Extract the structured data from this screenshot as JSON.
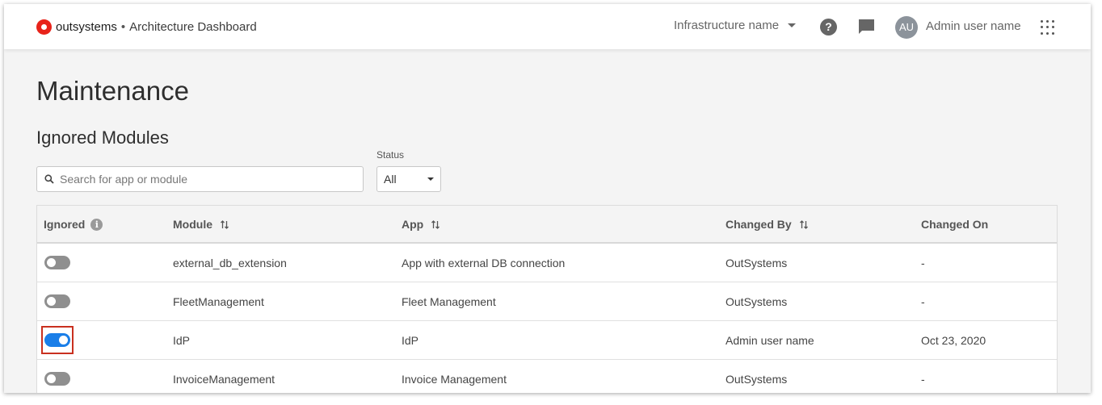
{
  "header": {
    "brand_name": "outsystems",
    "brand_separator": "•",
    "app_name": "Architecture Dashboard",
    "infrastructure_label": "Infrastructure name",
    "help_icon": "help-circle-icon",
    "chat_icon": "chat-bubble-icon",
    "avatar_initials": "AU",
    "user_name": "Admin user name",
    "apps_icon": "grid-apps-icon"
  },
  "page": {
    "title": "Maintenance",
    "section_title": "Ignored Modules"
  },
  "filters": {
    "search_placeholder": "Search for app or module",
    "search_value": "",
    "status_label": "Status",
    "status_value": "All"
  },
  "table": {
    "columns": {
      "ignored": "Ignored",
      "module": "Module",
      "app": "App",
      "changed_by": "Changed By",
      "changed_on": "Changed On"
    },
    "rows": [
      {
        "ignored": false,
        "module": "external_db_extension",
        "app": "App with external DB connection",
        "changed_by": "OutSystems",
        "changed_on": "-"
      },
      {
        "ignored": false,
        "module": "FleetManagement",
        "app": "Fleet Management",
        "changed_by": "OutSystems",
        "changed_on": "-"
      },
      {
        "ignored": true,
        "module": "IdP",
        "app": "IdP",
        "changed_by": "Admin user name",
        "changed_on": "Oct 23, 2020"
      },
      {
        "ignored": false,
        "module": "InvoiceManagement",
        "app": "Invoice Management",
        "changed_by": "OutSystems",
        "changed_on": "-"
      }
    ]
  },
  "colors": {
    "brand_red": "#e8231a",
    "toggle_on": "#1a7ee8",
    "toggle_off": "#8f8f8f",
    "highlight_border": "#c9301f"
  }
}
